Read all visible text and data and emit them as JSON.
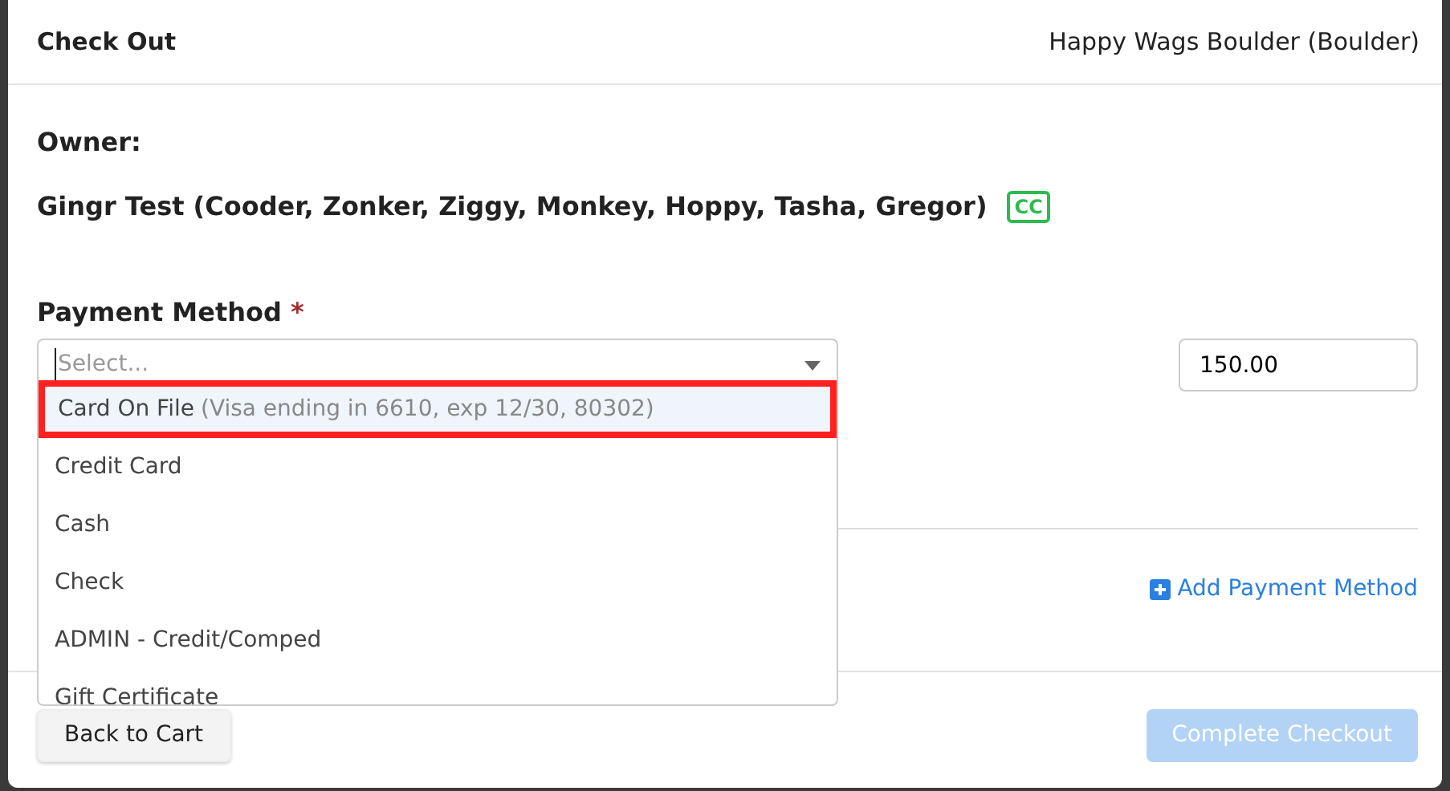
{
  "modal": {
    "title": "Check Out",
    "location": "Happy Wags Boulder (Boulder)"
  },
  "owner": {
    "label": "Owner:",
    "name": "Gingr Test (Cooder, Zonker, Ziggy, Monkey, Hoppy, Tasha, Gregor)",
    "badge": "CC"
  },
  "payment": {
    "label": "Payment Method",
    "required_mark": "*",
    "placeholder": "Select...",
    "amount": "150.00",
    "expanded": true,
    "options": [
      {
        "label": "Card On File",
        "detail": "(Visa ending in 6610, exp 12/30, 80302)",
        "highlighted": true
      },
      {
        "label": "Credit Card",
        "highlighted": false
      },
      {
        "label": "Cash",
        "highlighted": false
      },
      {
        "label": "Check",
        "highlighted": false
      },
      {
        "label": "ADMIN - Credit/Comped",
        "highlighted": false
      },
      {
        "label": "Gift Certificate",
        "highlighted": false
      }
    ]
  },
  "add_link": "Add Payment Method",
  "buttons": [
    {
      "label": "Back to Cart",
      "kind": "secondary",
      "disabled": false
    },
    {
      "label": "Complete Checkout",
      "kind": "primary",
      "disabled": true
    }
  ]
}
